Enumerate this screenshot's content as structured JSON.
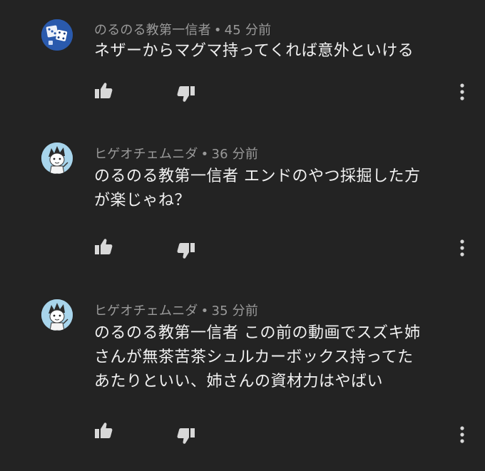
{
  "comments": [
    {
      "author": "のるのる教第一信者",
      "separator": "•",
      "time": "45 分前",
      "text": "ネザーからマグマ持ってくれば意外といける",
      "avatar": "blue-dice-avatar",
      "like_icon": "thumbs-up-icon",
      "dislike_icon": "thumbs-down-icon",
      "more_icon": "more-vertical-icon"
    },
    {
      "author": "ヒゲオチェムニダ",
      "separator": "•",
      "time": "36 分前",
      "text": "のるのる教第一信者 エンドのやつ採掘した方\nが楽じゃね？",
      "avatar": "anime-character-avatar",
      "like_icon": "thumbs-up-icon",
      "dislike_icon": "thumbs-down-icon",
      "more_icon": "more-vertical-icon"
    },
    {
      "author": "ヒゲオチェムニダ",
      "separator": "•",
      "time": "35 分前",
      "text": "のるのる教第一信者 この前の動画でスズキ姉\nさんが無茶苦茶シュルカーボックス持ってた\nあたりといい、姉さんの資材力はやばい",
      "avatar": "anime-character-avatar",
      "like_icon": "thumbs-up-icon",
      "dislike_icon": "thumbs-down-icon",
      "more_icon": "more-vertical-icon"
    }
  ],
  "colors": {
    "background": "#232323",
    "meta_text": "#9a9a9a",
    "body_text": "#f1f1f1",
    "icon": "#d8d8d8"
  }
}
